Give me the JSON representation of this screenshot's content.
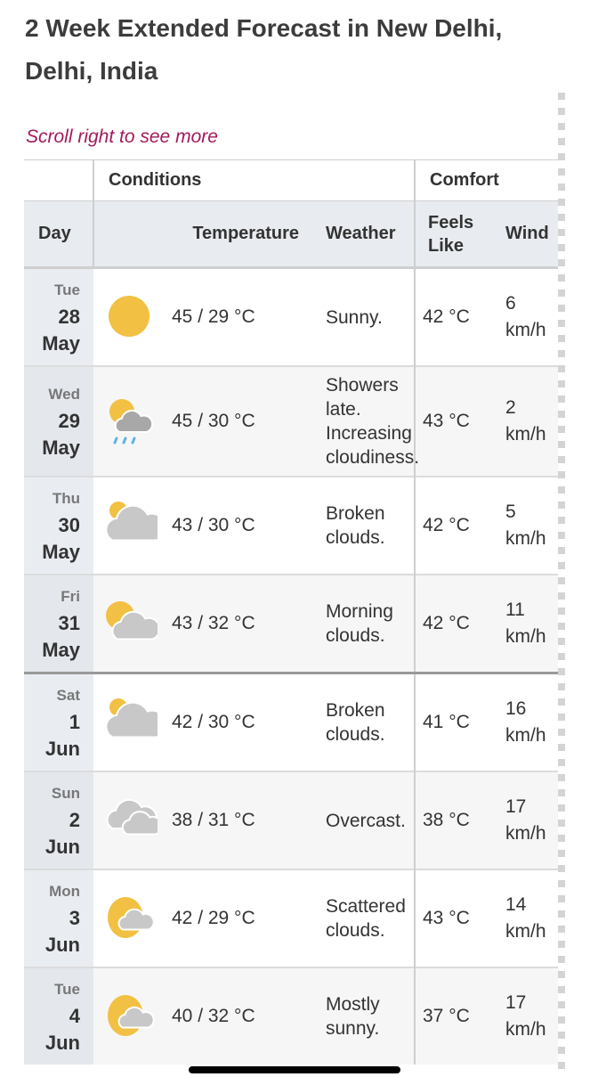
{
  "page": {
    "title": "2 Week Extended Forecast in New Delhi, Delhi, India",
    "scroll_hint": "Scroll right to see more"
  },
  "colors": {
    "hint": "#a3195b",
    "sun": "#f2c043",
    "cloud": "#c8c8c8",
    "rain_cloud": "#a8a8a8",
    "rain": "#5fb3e0"
  },
  "table": {
    "group_headers": {
      "conditions": "Conditions",
      "comfort": "Comfort"
    },
    "columns": {
      "day": "Day",
      "temperature": "Temperature",
      "weather": "Weather",
      "feels_like": "Feels Like",
      "wind": "Wind"
    },
    "rows": [
      {
        "dow": "Tue",
        "day": "28",
        "month": "May",
        "icon": "sunny-icon",
        "temp": "45 / 29 °C",
        "weather": "Sunny.",
        "feels": "42 °C",
        "wind_value": "6",
        "wind_unit": "km/h"
      },
      {
        "dow": "Wed",
        "day": "29",
        "month": "May",
        "icon": "sun-rain-cloud-icon",
        "temp": "45 / 30 °C",
        "weather": "Showers late. Increasing cloudiness.",
        "feels": "43 °C",
        "wind_value": "2",
        "wind_unit": "km/h"
      },
      {
        "dow": "Thu",
        "day": "30",
        "month": "May",
        "icon": "broken-clouds-icon",
        "temp": "43 / 30 °C",
        "weather": "Broken clouds.",
        "feels": "42 °C",
        "wind_value": "5",
        "wind_unit": "km/h"
      },
      {
        "dow": "Fri",
        "day": "31",
        "month": "May",
        "icon": "morning-clouds-icon",
        "temp": "43 / 32 °C",
        "weather": "Morning clouds.",
        "feels": "42 °C",
        "wind_value": "11",
        "wind_unit": "km/h"
      },
      {
        "dow": "Sat",
        "day": "1",
        "month": "Jun",
        "icon": "broken-clouds-icon",
        "temp": "42 / 30 °C",
        "weather": "Broken clouds.",
        "feels": "41 °C",
        "wind_value": "16",
        "wind_unit": "km/h"
      },
      {
        "dow": "Sun",
        "day": "2",
        "month": "Jun",
        "icon": "overcast-icon",
        "temp": "38 / 31 °C",
        "weather": "Overcast.",
        "feels": "38 °C",
        "wind_value": "17",
        "wind_unit": "km/h"
      },
      {
        "dow": "Mon",
        "day": "3",
        "month": "Jun",
        "icon": "scattered-clouds-icon",
        "temp": "42 / 29 °C",
        "weather": "Scattered clouds.",
        "feels": "43 °C",
        "wind_value": "14",
        "wind_unit": "km/h"
      },
      {
        "dow": "Tue",
        "day": "4",
        "month": "Jun",
        "icon": "mostly-sunny-icon",
        "temp": "40 / 32 °C",
        "weather": "Mostly sunny.",
        "feels": "37 °C",
        "wind_value": "17",
        "wind_unit": "km/h"
      }
    ]
  }
}
